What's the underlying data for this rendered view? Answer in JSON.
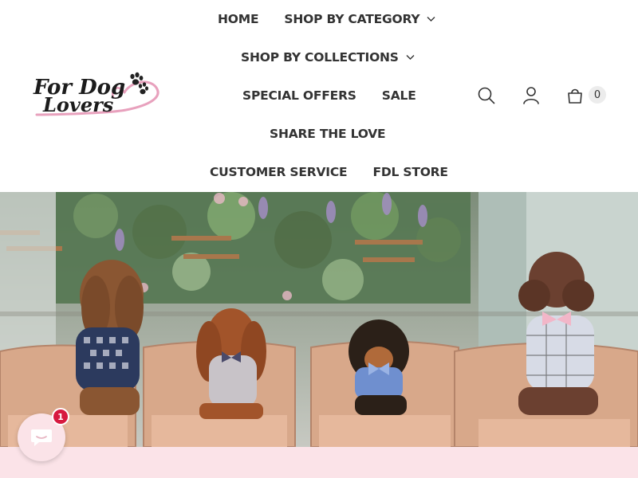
{
  "logo": {
    "line1": "For Dog",
    "line2": "Lovers",
    "icon": "paw-heart-logo"
  },
  "nav": {
    "home": "HOME",
    "shop_by_category": "SHOP BY CATEGORY",
    "shop_by_collections": "SHOP BY COLLECTIONS",
    "special_offers": "SPECIAL OFFERS",
    "sale": "SALE",
    "share_the_love": "SHARE THE LOVE",
    "customer_service": "CUSTOMER SERVICE",
    "fdl_store": "FDL STORE"
  },
  "header_icons": {
    "search": "search-icon",
    "account": "user-icon",
    "cart": "shopping-bag-icon",
    "cart_count": "0"
  },
  "hero": {
    "description_icon": "hero-image"
  },
  "chat": {
    "icon": "chat-bubble-icon",
    "badge_count": "1"
  },
  "colors": {
    "text": "#333333",
    "logo_pink": "#e8a1bd",
    "promo_strip": "#fbe3e8",
    "chat_badge": "#d7193f"
  }
}
